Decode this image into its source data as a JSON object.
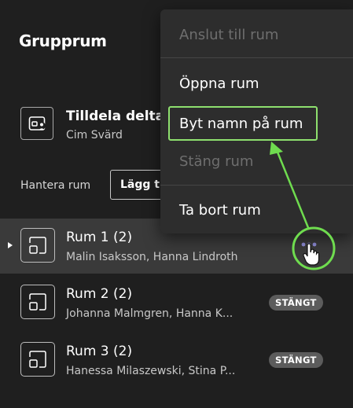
{
  "title": "Grupprum",
  "assign": {
    "label": "Tilldela delta",
    "subtitle": "Cim Svärd"
  },
  "manage": {
    "label": "Hantera rum",
    "add_button": "Lägg till rum"
  },
  "rooms": [
    {
      "name": "Rum 1 (2)",
      "members": "Malin Isaksson, Hanna Lindroth",
      "selected": true
    },
    {
      "name": "Rum 2 (2)",
      "members": "Johanna Malmgren, Hanna K...",
      "badge": "STÄNGT"
    },
    {
      "name": "Rum 3 (2)",
      "members": "Hanessa Milaszewski, Stina P...",
      "badge": "STÄNGT"
    }
  ],
  "context_menu": {
    "items": [
      {
        "label": "Anslut till rum",
        "disabled": true
      },
      {
        "label": "Öppna rum",
        "disabled": false
      },
      {
        "label": "Byt namn på rum",
        "disabled": false,
        "highlighted": true
      },
      {
        "label": "Stäng rum",
        "disabled": true
      },
      {
        "label": "Ta bort rum",
        "disabled": false
      }
    ]
  },
  "icons": [
    "assign-participants-icon",
    "room-icon",
    "more-options-icon",
    "hand-cursor-icon",
    "pointer-arrow"
  ],
  "colors": {
    "background": "#1f1f1f",
    "menu": "#2d2d2d",
    "selected_row": "#3a3a3a",
    "accent": "#8e8bd6",
    "annotation": "#6fdc4f",
    "badge": "#5c5c5c"
  }
}
